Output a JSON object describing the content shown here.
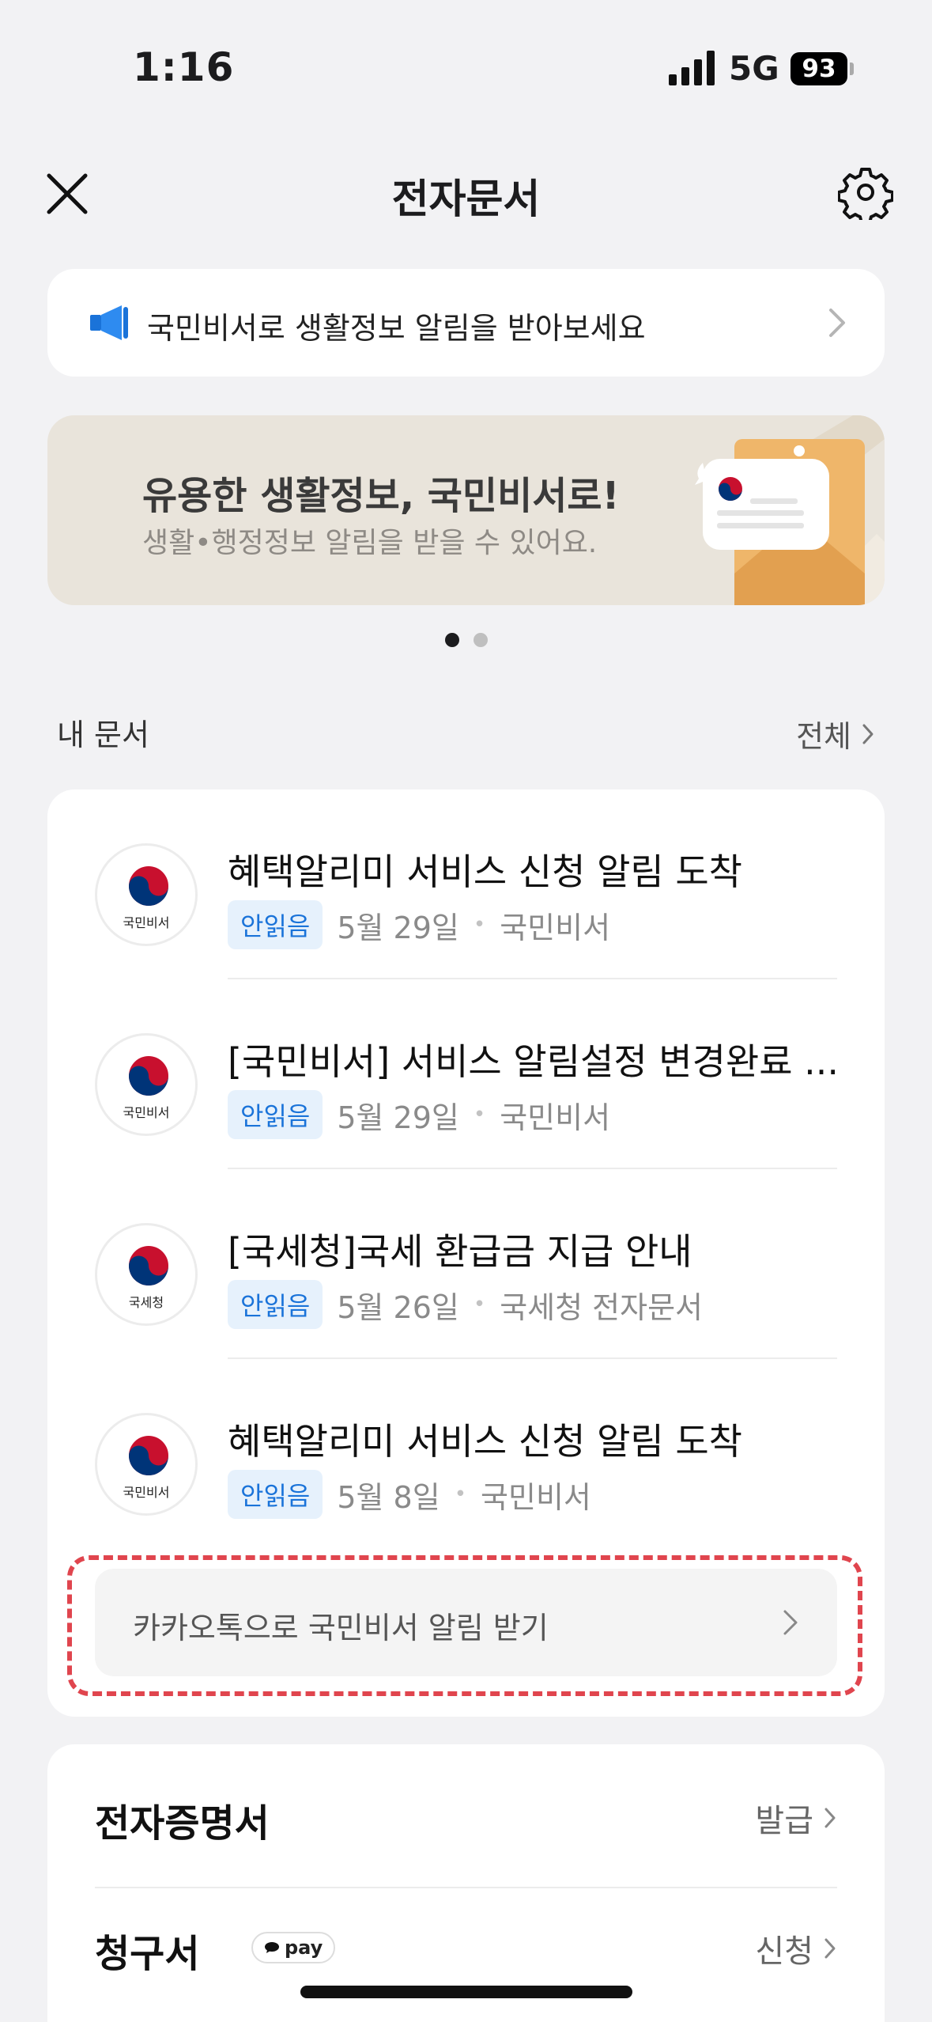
{
  "status_bar": {
    "time": "1:16",
    "network": "5G",
    "battery": "93"
  },
  "nav": {
    "title": "전자문서"
  },
  "notice": {
    "text": "국민비서로 생활정보 알림을 받아보세요"
  },
  "banner": {
    "title": "유용한 생활정보, 국민비서로!",
    "subtitle": "생활•행정정보 알림을 받을 수 있어요.",
    "page_index": 1,
    "page_count": 2
  },
  "my_docs": {
    "title": "내 문서",
    "more_label": "전체",
    "items": [
      {
        "logo_text": "국민비서",
        "title": "혜택알리미 서비스 신청 알림 도착",
        "badge": "안읽음",
        "date": "5월 29일",
        "sender": "국민비서"
      },
      {
        "logo_text": "국민비서",
        "title": "[국민비서] 서비스 알림설정 변경완료 ...",
        "badge": "안읽음",
        "date": "5월 29일",
        "sender": "국민비서"
      },
      {
        "logo_text": "국세청",
        "title": "[국세청]국세 환급금 지급 안내",
        "badge": "안읽음",
        "date": "5월 26일",
        "sender": "국세청 전자문서"
      },
      {
        "logo_text": "국민비서",
        "title": "혜택알리미 서비스 신청 알림 도착",
        "badge": "안읽음",
        "date": "5월 8일",
        "sender": "국민비서"
      }
    ],
    "kakao_button": "카카오톡으로 국민비서 알림 받기"
  },
  "certs": {
    "e_cert_label": "전자증명서",
    "e_cert_action": "발급",
    "bill_label": "청구서",
    "bill_badge": "pay",
    "bill_action": "신청"
  },
  "colors": {
    "background": "#f2f2f4",
    "accent_blue": "#1a73d9",
    "highlight_red": "#e0454e",
    "banner_bg": "#e9e4db"
  }
}
